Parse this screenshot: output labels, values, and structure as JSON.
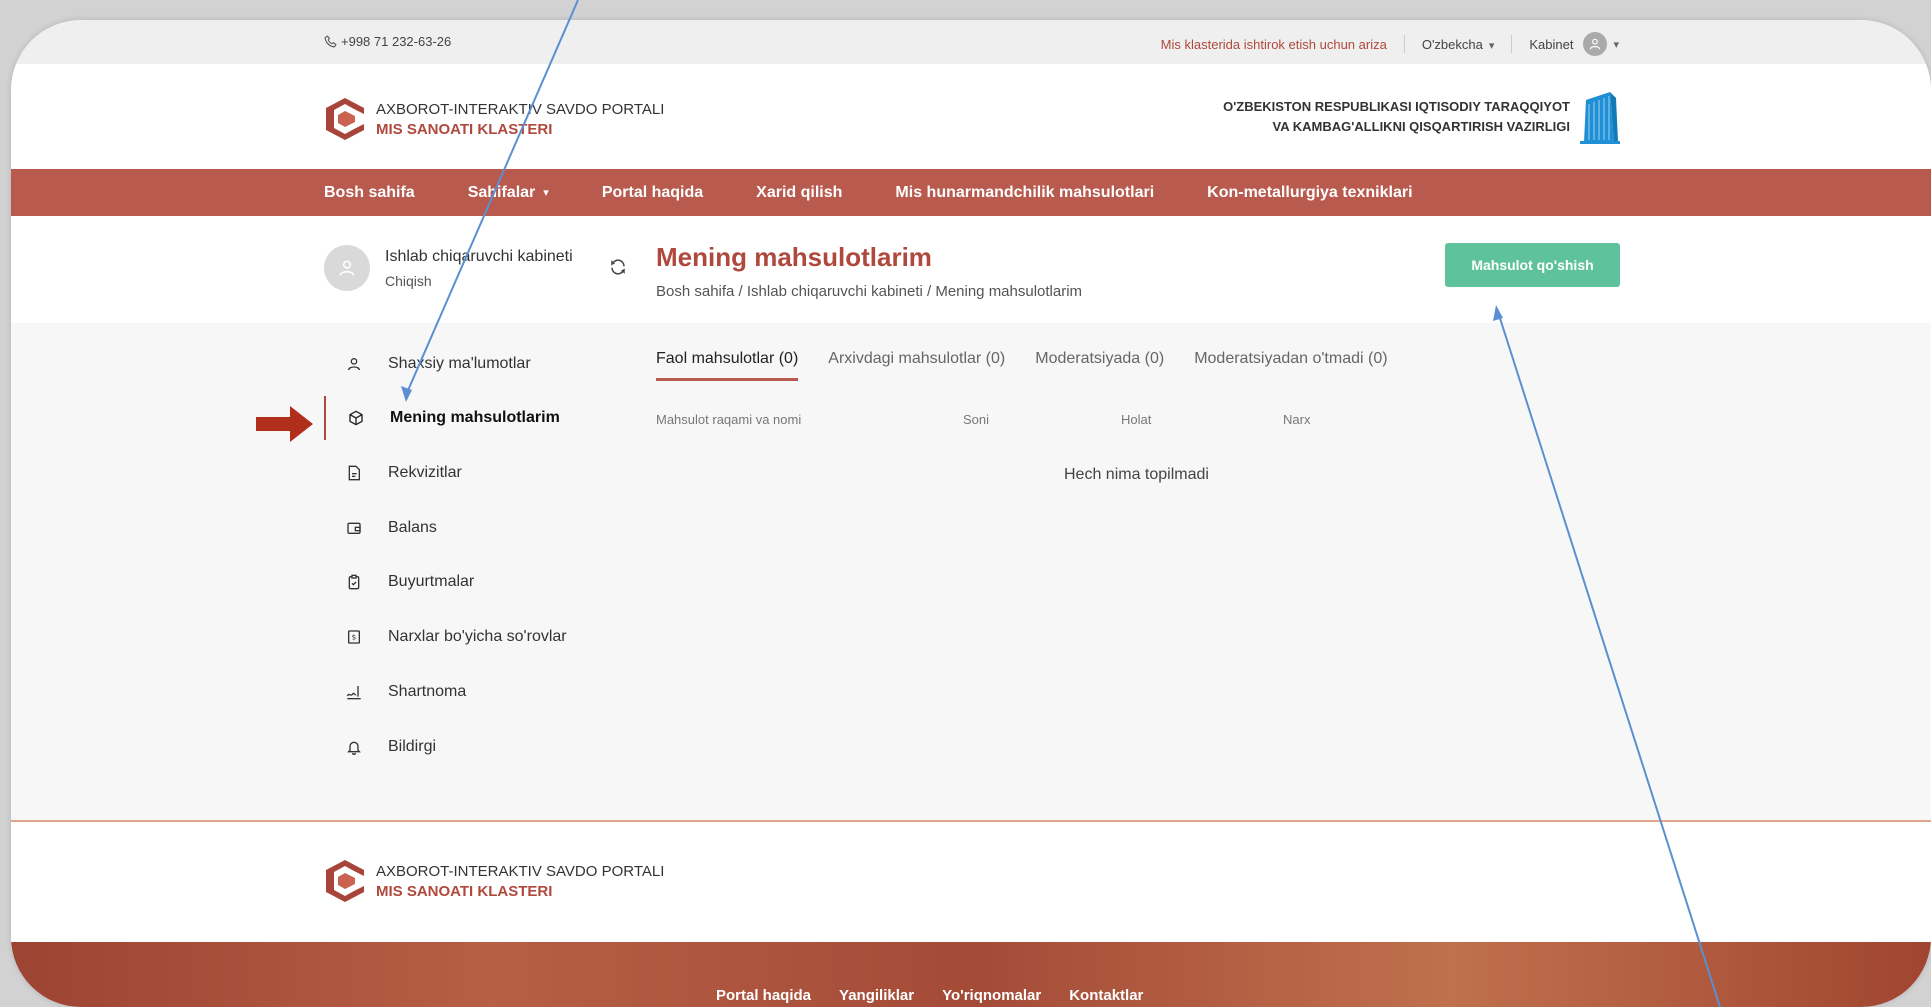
{
  "topbar": {
    "phone": "+998 71 232-63-26",
    "apply_link": "Mis klasterida ishtirok etish uchun ariza",
    "language": "O'zbekcha",
    "cabinet": "Kabinet"
  },
  "brand": {
    "line1": "AXBOROT-INTERAKTIV SAVDO PORTALI",
    "line2": "MIS SANOATI KLASTERI"
  },
  "ministry": {
    "line1": "O'ZBEKISTON RESPUBLIKASI IQTISODIY TARAQQIYOT",
    "line2": "VA KAMBAG'ALLIKNI QISQARTIRISH VAZIRLIGI"
  },
  "nav": {
    "items": [
      "Bosh sahifa",
      "Sahifalar",
      "Portal haqida",
      "Xarid qilish",
      "Mis hunarmandchilik mahsulotlari",
      "Kon-metallurgiya texniklari"
    ]
  },
  "profile": {
    "name": "Ishlab chiqaruvchi kabineti",
    "logout": "Chiqish"
  },
  "page": {
    "title": "Mening mahsulotlarim",
    "breadcrumb": "Bosh sahifa / Ishlab chiqaruvchi kabineti / Mening mahsulotlarim",
    "add_button": "Mahsulot qo'shish"
  },
  "sidebar": {
    "items": [
      {
        "label": "Shaxsiy ma'lumotlar",
        "icon": "user-icon"
      },
      {
        "label": "Mening mahsulotlarim",
        "icon": "box-icon"
      },
      {
        "label": "Rekvizitlar",
        "icon": "document-icon"
      },
      {
        "label": "Balans",
        "icon": "wallet-icon"
      },
      {
        "label": "Buyurtmalar",
        "icon": "clipboard-icon"
      },
      {
        "label": "Narxlar bo'yicha so'rovlar",
        "icon": "price-icon"
      },
      {
        "label": "Shartnoma",
        "icon": "signature-icon"
      },
      {
        "label": "Bildirgi",
        "icon": "bell-icon"
      }
    ]
  },
  "tabs": [
    "Faol mahsulotlar (0)",
    "Arxivdagi mahsulotlar (0)",
    "Moderatsiyada (0)",
    "Moderatsiyadan o'tmadi (0)"
  ],
  "table": {
    "columns": [
      "Mahsulot raqami va nomi",
      "Soni",
      "Holat",
      "Narx"
    ],
    "empty": "Hech nima topilmadi"
  },
  "footer": {
    "nav": [
      "Portal haqida",
      "Yangiliklar",
      "Yo'riqnomalar",
      "Kontaktlar"
    ]
  },
  "colors": {
    "brand": "#b0493d",
    "nav_bg": "#b85a4d",
    "button": "#5ec39c",
    "annotation": "#5b8fd1",
    "arrow": "#b12e1a"
  }
}
